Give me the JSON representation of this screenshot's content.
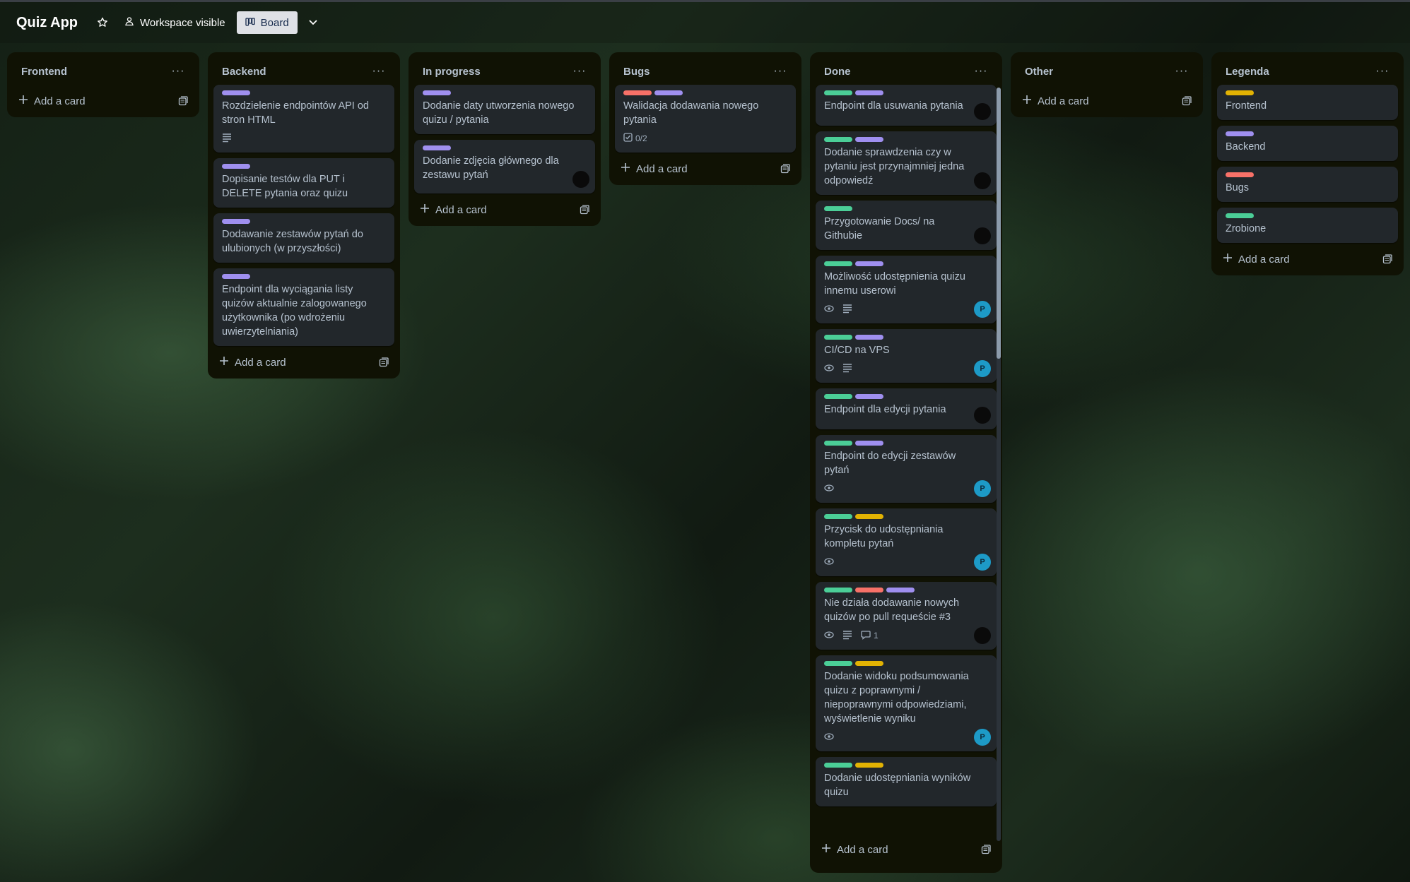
{
  "header": {
    "board_title": "Quiz App",
    "visibility_label": "Workspace visible",
    "view_label": "Board"
  },
  "colors": {
    "green": "#4bce97",
    "purple": "#9f8fef",
    "red": "#f87168",
    "yellow": "#e2b203"
  },
  "add_card_label": "Add a card",
  "lists": [
    {
      "title": "Frontend",
      "cards": []
    },
    {
      "title": "Backend",
      "cards": [
        {
          "title": "Rozdzielenie endpointów API od stron HTML",
          "labels": [
            "purple"
          ]
        },
        {
          "title": "Dopisanie testów dla PUT i DELETE pytania oraz quizu",
          "labels": [
            "purple"
          ]
        },
        {
          "title": "Dodawanie zestawów pytań do ulubionych (w przyszłości)",
          "labels": [
            "purple"
          ]
        },
        {
          "title": "Endpoint dla wyciągania listy quizów aktualnie zalogowanego użytkownika (po wdrożeniu uwierzytelniania)",
          "labels": [
            "purple"
          ]
        }
      ]
    },
    {
      "title": "In progress",
      "cards": [
        {
          "title": "Dodanie daty utworzenia nowego quizu / pytania",
          "labels": [
            "purple"
          ]
        },
        {
          "title": "Dodanie zdjęcia głównego dla zestawu pytań",
          "labels": [
            "purple"
          ]
        }
      ]
    },
    {
      "title": "Bugs",
      "cards": [
        {
          "title": "Walidacja dodawania nowego pytania",
          "labels": [
            "red",
            "purple"
          ],
          "checklist": "0/2"
        }
      ]
    },
    {
      "title": "Done",
      "cards": [
        {
          "title": "Endpoint dla usuwania pytania",
          "labels": [
            "green",
            "purple"
          ]
        },
        {
          "title": "Dodanie sprawdzenia czy w pytaniu jest przynajmniej jedna odpowiedź",
          "labels": [
            "green",
            "purple"
          ]
        },
        {
          "title": "Przygotowanie Docs/ na Githubie",
          "labels": [
            "green"
          ]
        },
        {
          "title": "Możliwość udostępnienia quizu innemu userowi",
          "labels": [
            "green",
            "purple"
          ],
          "avatar": "P"
        },
        {
          "title": "CI/CD na VPS",
          "labels": [
            "green",
            "purple"
          ],
          "avatar": "P"
        },
        {
          "title": "Endpoint dla edycji pytania",
          "labels": [
            "green",
            "purple"
          ]
        },
        {
          "title": "Endpoint do edycji zestawów pytań",
          "labels": [
            "green",
            "purple"
          ],
          "avatar": "P"
        },
        {
          "title": "Przycisk do udostępniania kompletu pytań",
          "labels": [
            "green",
            "yellow"
          ],
          "avatar": "P"
        },
        {
          "title": "Nie działa dodawanie nowych quizów po pull requeście #3",
          "labels": [
            "green",
            "red",
            "purple"
          ],
          "comments": "1"
        },
        {
          "title": "Dodanie widoku podsumowania quizu z poprawnymi / niepoprawnymi odpowiedziami, wyświetlenie wyniku",
          "labels": [
            "green",
            "yellow"
          ],
          "avatar": "P"
        },
        {
          "title": "Dodanie udostępniania wyników quizu",
          "labels": [
            "green",
            "yellow"
          ]
        }
      ]
    },
    {
      "title": "Other",
      "cards": []
    },
    {
      "title": "Legenda",
      "cards": [
        {
          "title": "Frontend",
          "labels": [
            "yellow"
          ]
        },
        {
          "title": "Backend",
          "labels": [
            "purple"
          ]
        },
        {
          "title": "Bugs",
          "labels": [
            "red"
          ]
        },
        {
          "title": "Zrobione",
          "labels": [
            "green"
          ]
        }
      ]
    }
  ]
}
